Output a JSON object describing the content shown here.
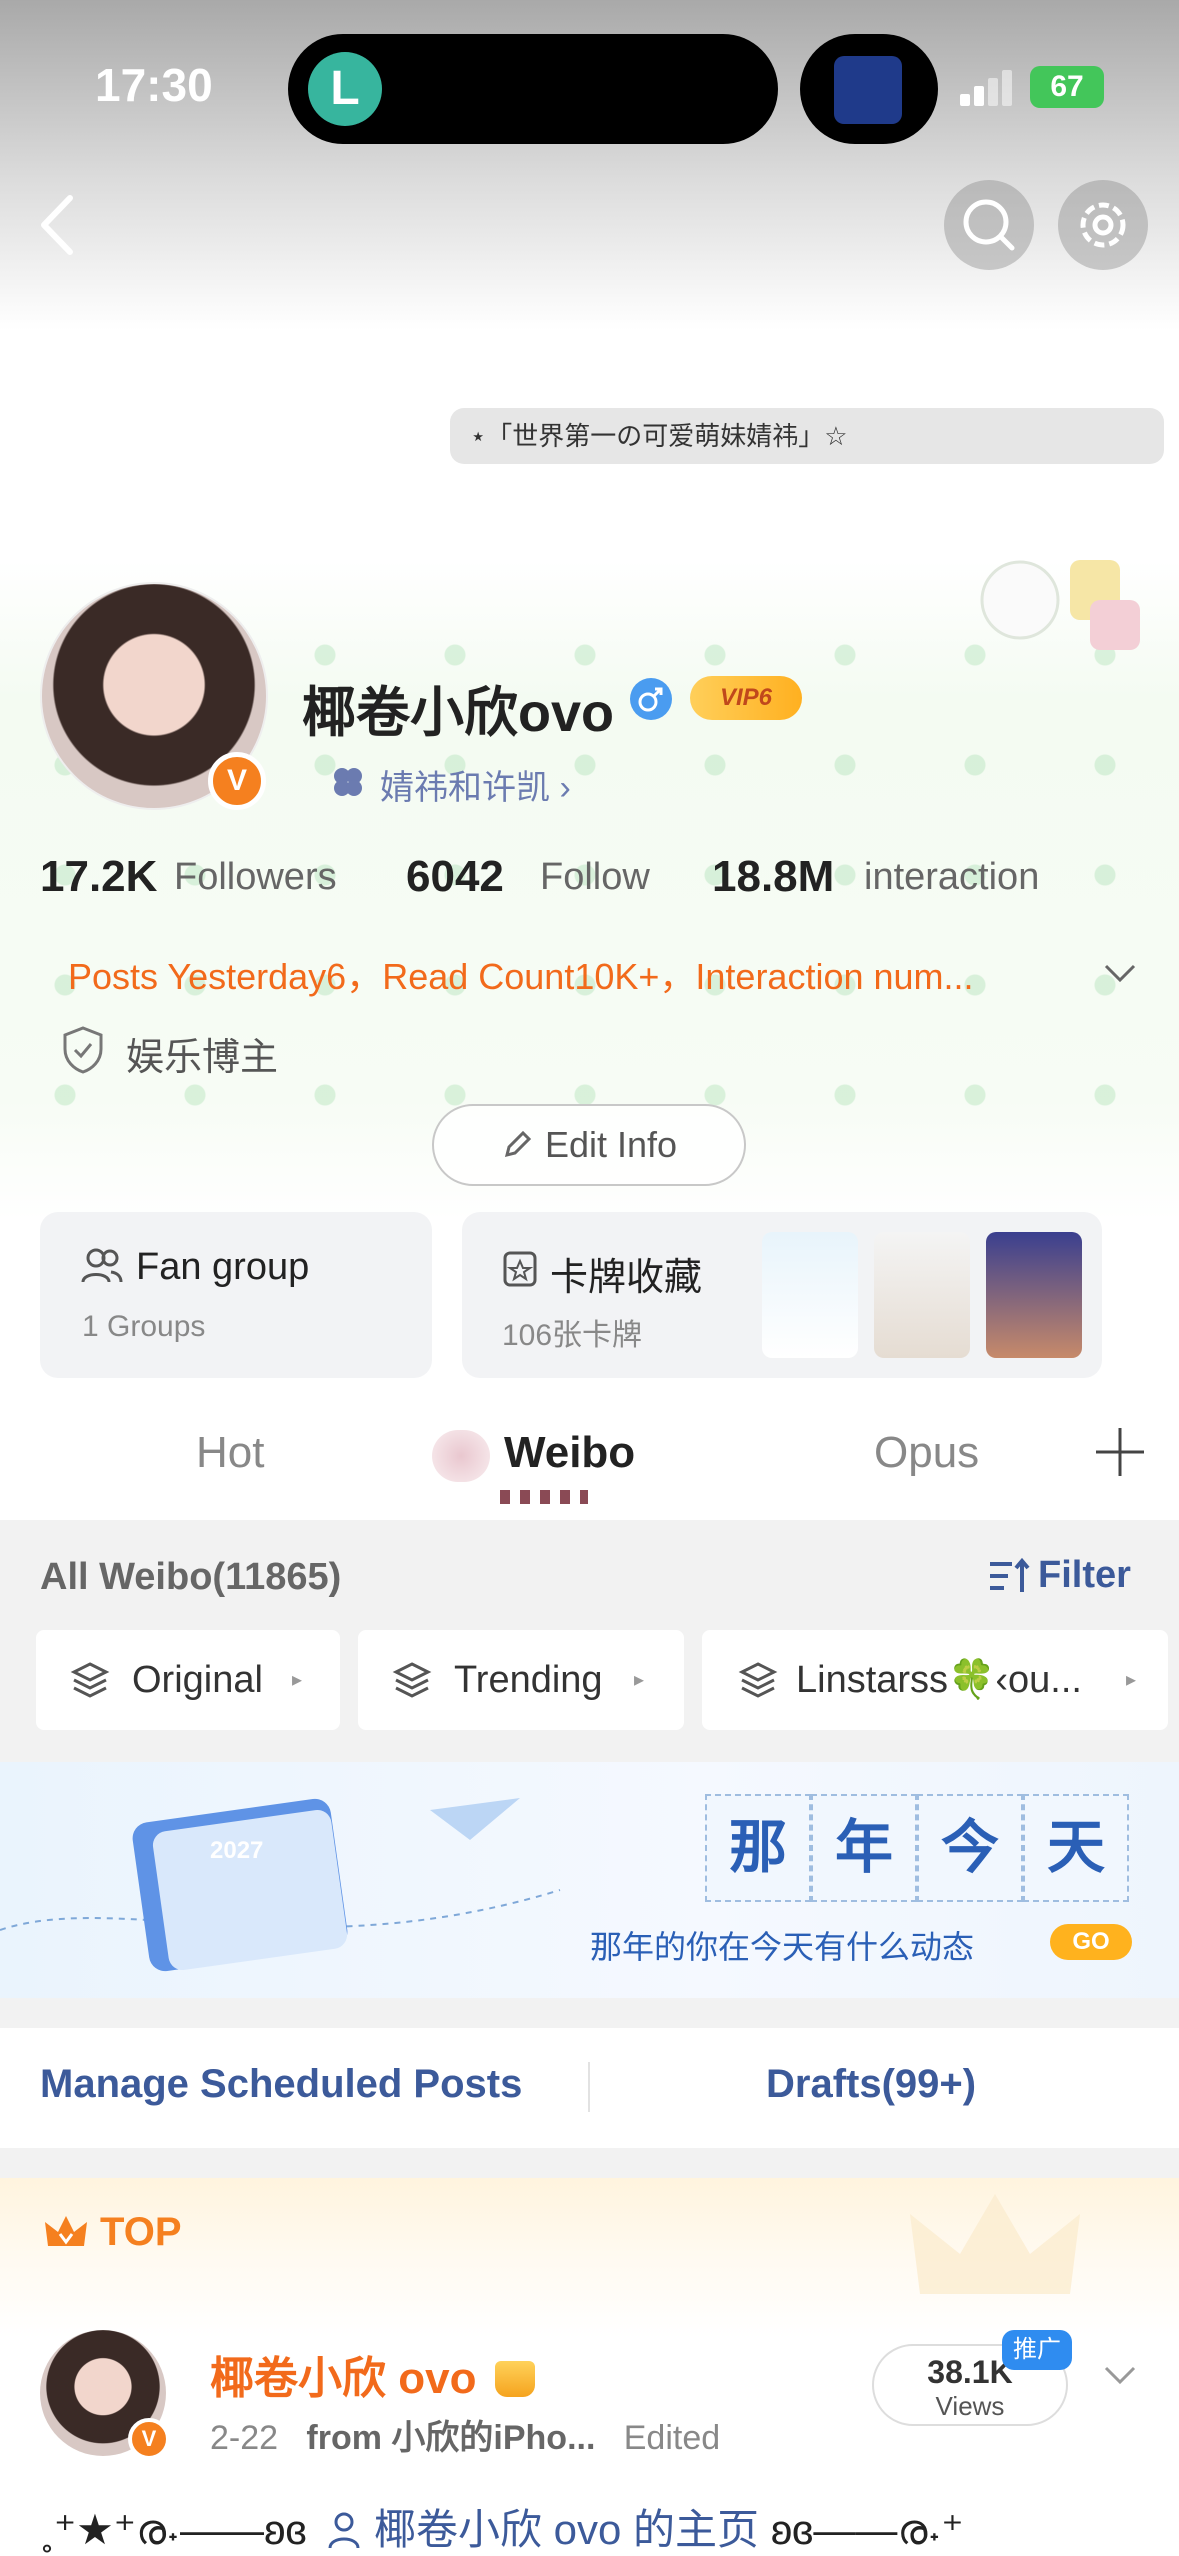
{
  "status_bar": {
    "time": "17:30",
    "battery": "67",
    "island_app_letter": "L"
  },
  "header": {
    "motto": "⋆「世界第一の可爱萌妹婧祎」☆"
  },
  "profile": {
    "username": "椰卷小欣ovo",
    "vip_label": "VIP6",
    "verified_badge": "V",
    "sub_relation": "婧祎和许凯 ›",
    "stats": {
      "followers_value": "17.2K",
      "followers_label": "Followers",
      "follow_value": "6042",
      "follow_label": "Follow",
      "interaction_value": "18.8M",
      "interaction_label": "interaction"
    },
    "posts_summary": "Posts Yesterday6，Read Count10K+，Interaction num...",
    "tag": "娱乐博主",
    "edit_label": "Edit Info"
  },
  "cards": {
    "fan_group": {
      "title": "Fan group",
      "sub": "1 Groups"
    },
    "card_collection": {
      "title": "卡牌收藏",
      "sub": "106张卡牌"
    }
  },
  "tabs": [
    {
      "label": "Hot"
    },
    {
      "label": "Weibo",
      "active": true
    },
    {
      "label": "Opus"
    }
  ],
  "feed": {
    "all_weibo": "All Weibo(11865)",
    "filter": "Filter",
    "chips": [
      "Original",
      "Trending",
      "Linstarss🍀‹ou..."
    ],
    "banner": {
      "chars": [
        "那",
        "年",
        "今",
        "天"
      ],
      "sub": "那年的你在今天有什么动态",
      "go": "GO",
      "calendar_year": "2027"
    },
    "manage": "Manage Scheduled Posts",
    "drafts": "Drafts(99+)"
  },
  "post": {
    "top_label": "TOP",
    "author": "椰卷小欣 ovo",
    "date": "2-22",
    "from": "from 小欣的iPho...",
    "edited": "Edited",
    "views_value": "38.1K",
    "views_label": "Views",
    "promo": "推广",
    "body_prefix": "˳⁺★⁺ര˖——ʚɞ",
    "body_link": "椰卷小欣 ovo 的主页",
    "body_suffix": "ʚɞ——ര˖⁺"
  },
  "colors": {
    "accent_orange": "#f26a1b",
    "link_blue": "#3c5a9a",
    "vip_gold": "#ffb020"
  },
  "icons": [
    "back-arrow-icon",
    "search-icon",
    "gear-icon",
    "male-icon",
    "clover-icon",
    "chevron-down-icon",
    "shield-icon",
    "pencil-icon",
    "people-icon",
    "card-icon",
    "plus-icon",
    "filter-icon",
    "layers-icon",
    "crown-icon",
    "person-icon"
  ]
}
